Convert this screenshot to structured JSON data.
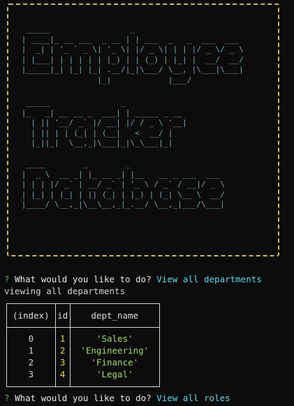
{
  "banner": {
    "line1": "  _____                 _\n | ____|_ __ ___  _ __ | | ___  _   _  ___  ___\n |  _| | '_ ` _ \\| '_ \\| |/ _ \\| | | |/ _ \\/ _ \\\n | |___| | | | | | |_) | | (_) | |_| |  __/  __/\n |_____|_| |_| |_| .__/|_|\\___/ \\__, |\\___|\\___|\n                 |_|            |___/",
    "line2": "  _____               _\n |_   _| __ __ _  ___| | _____ _ __\n   | || '__/ _` |/ __| |/ / _ \\ '__|\n   | || | | (_| | (__|   <  __/ |\n   |_||_|  \\__,_|\\___|_|\\_\\___|_|",
    "line3": "  ____        _        _\n |  _ \\  __ _| |_ __ _| |__   __ _ ___  ___\n | | | |/ _` | __/ _` | '_ \\ / _` / __|/ _ \\\n | |_| | (_| | || (_| | |_) | (_| \\__ \\  __/\n |____/ \\__,_|\\__\\__,_|_.__/ \\__,_|___/\\___|"
  },
  "prompt1": {
    "mark": "?",
    "question": "What would you like to do?",
    "answer": "View all departments"
  },
  "status_text": "viewing all departments",
  "table": {
    "headers": [
      "(index)",
      "id",
      "dept_name"
    ],
    "rows": [
      {
        "index": "0",
        "id": "1",
        "dept_name": "'Sales'"
      },
      {
        "index": "1",
        "id": "2",
        "dept_name": "'Engineering'"
      },
      {
        "index": "2",
        "id": "3",
        "dept_name": "'Finance'"
      },
      {
        "index": "3",
        "id": "4",
        "dept_name": "'Legal'"
      }
    ]
  },
  "prompt2": {
    "mark": "?",
    "question": "What would you like to do?",
    "answer": "View all roles"
  },
  "colors": {
    "background": "#0c0c0c",
    "banner_border": "#c8b96a",
    "ascii": "#7aa9b5",
    "question_mark": "#5fb36a",
    "answer": "#5fd7e8",
    "id_value": "#e6d34a",
    "string_value": "#9fd96e"
  }
}
